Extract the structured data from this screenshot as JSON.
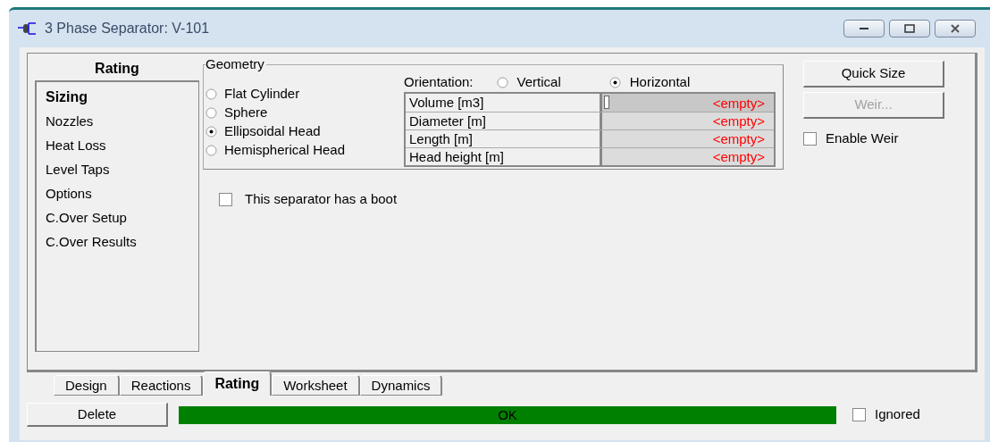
{
  "window": {
    "title": "3 Phase Separator: V-101"
  },
  "sidebar": {
    "title": "Rating",
    "items": [
      {
        "label": "Sizing",
        "selected": true
      },
      {
        "label": "Nozzles",
        "selected": false
      },
      {
        "label": "Heat Loss",
        "selected": false
      },
      {
        "label": "Level Taps",
        "selected": false
      },
      {
        "label": "Options",
        "selected": false
      },
      {
        "label": "C.Over Setup",
        "selected": false
      },
      {
        "label": "C.Over Results",
        "selected": false
      }
    ]
  },
  "geometry": {
    "title": "Geometry",
    "shapes": [
      {
        "label": "Flat Cylinder",
        "selected": false
      },
      {
        "label": "Sphere",
        "selected": false
      },
      {
        "label": "Ellipsoidal Head",
        "selected": true
      },
      {
        "label": "Hemispherical Head",
        "selected": false
      }
    ],
    "orientation": {
      "label": "Orientation:",
      "options": [
        {
          "label": "Vertical",
          "selected": false
        },
        {
          "label": "Horizontal",
          "selected": true
        }
      ]
    },
    "table": {
      "rows": [
        {
          "name": "Volume [m3]",
          "value": "<empty>",
          "focused": true
        },
        {
          "name": "Diameter [m]",
          "value": "<empty>",
          "focused": false
        },
        {
          "name": "Length [m]",
          "value": "<empty>",
          "focused": false
        },
        {
          "name": "Head height [m]",
          "value": "<empty>",
          "focused": false
        }
      ]
    }
  },
  "boot": {
    "label": "This separator has a boot",
    "checked": false
  },
  "buttons": [
    {
      "label": "Quick Size",
      "disabled": false
    },
    {
      "label": "Weir...",
      "disabled": true
    }
  ],
  "enable_weir": {
    "label": "Enable Weir",
    "checked": false
  },
  "tabs": [
    {
      "label": "Design",
      "selected": false
    },
    {
      "label": "Reactions",
      "selected": false
    },
    {
      "label": "Rating",
      "selected": true
    },
    {
      "label": "Worksheet",
      "selected": false
    },
    {
      "label": "Dynamics",
      "selected": false
    }
  ],
  "delete_button": "Delete",
  "status": {
    "text": "OK",
    "color": "#008000"
  },
  "ignored": {
    "label": "Ignored",
    "checked": false
  }
}
